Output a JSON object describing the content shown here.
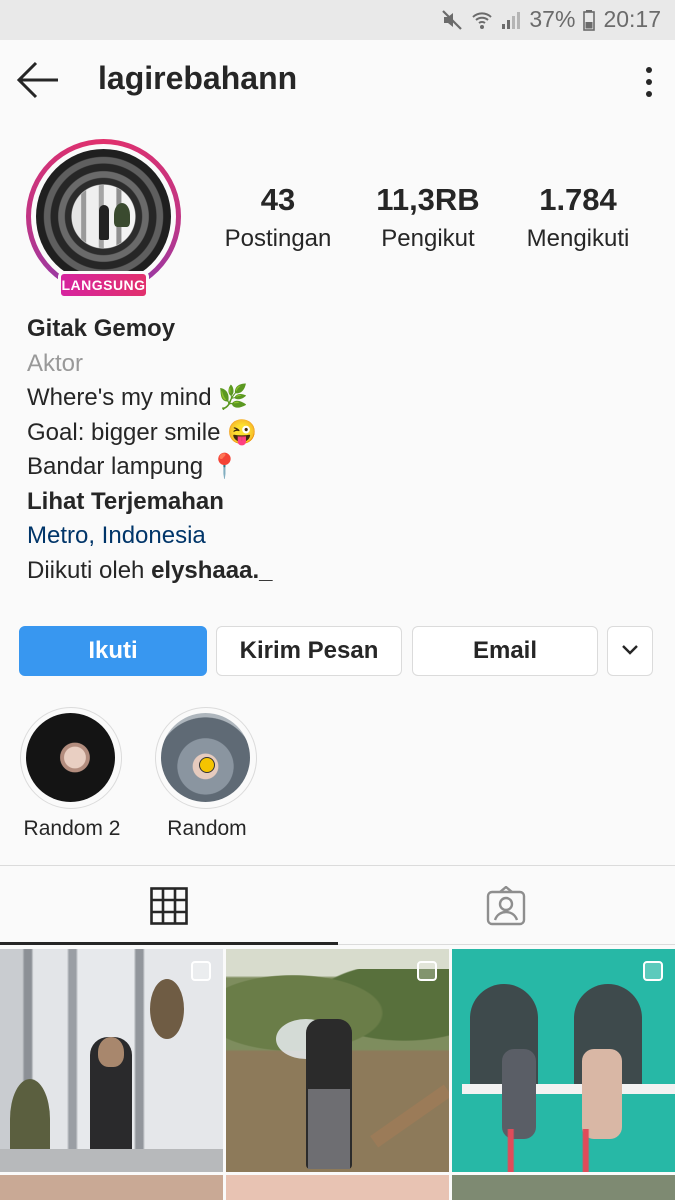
{
  "status": {
    "battery": "37%",
    "time": "20:17"
  },
  "header": {
    "username": "lagirebahann"
  },
  "profile": {
    "live_badge": "LANGSUNG",
    "stats": [
      {
        "value": "43",
        "label": "Postingan"
      },
      {
        "value": "11,3RB",
        "label": "Pengikut"
      },
      {
        "value": "1.784",
        "label": "Mengikuti"
      }
    ],
    "name": "Gitak Gemoy",
    "category": "Aktor",
    "bio_lines": [
      "Where's my mind 🌿",
      "Goal: bigger smile 😜",
      "Bandar lampung 📍"
    ],
    "translate": "Lihat Terjemahan",
    "location": "Metro, Indonesia",
    "followed_by_prefix": "Diikuti oleh ",
    "followed_by_user": "elyshaaa._"
  },
  "actions": {
    "follow": "Ikuti",
    "message": "Kirim Pesan",
    "email": "Email"
  },
  "highlights": [
    {
      "label": "Random 2"
    },
    {
      "label": "Random"
    }
  ],
  "colors": {
    "follow_blue": "#3897f0",
    "location_link": "#003569",
    "live_gradient_start": "#d6249f",
    "live_gradient_end": "#e1306c"
  }
}
